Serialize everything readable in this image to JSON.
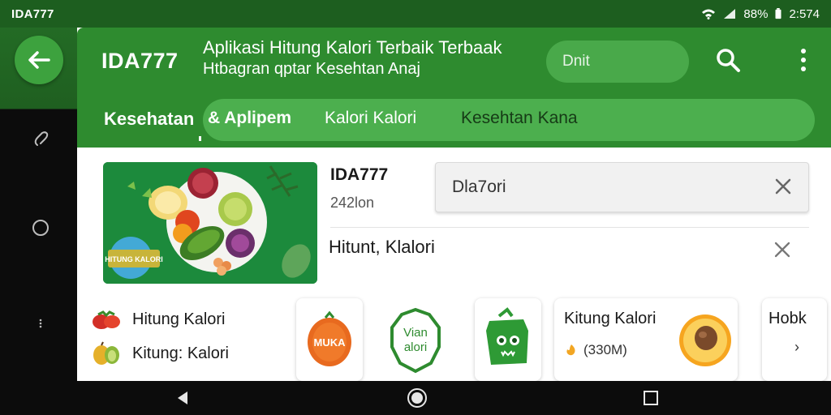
{
  "status_bar": {
    "carrier": "IDA777",
    "battery": "88%",
    "time": "2:574"
  },
  "app_bar": {
    "brand": "IDA777",
    "title_line1": "Aplikasi Hitung Kalori Terbaik Terbaak",
    "title_line2": "Htbagran qptar Kesehtan Anaj",
    "search_text": "Dnit"
  },
  "tabs": {
    "first": "Kesehatan",
    "items": [
      "& Aplipem",
      "Kalori Kalori",
      "Kesehtan Kana"
    ]
  },
  "hero": {
    "badge_text": "HITUNG KALORI",
    "name": "IDA777",
    "sub": "242lon"
  },
  "field_1": {
    "value": "Dla7ori"
  },
  "row_2": {
    "label": "Hitunt, Klalori"
  },
  "list": {
    "items": [
      {
        "label": "Hitung Kalori",
        "icon": "tomato-icon"
      },
      {
        "label": "Kitung: Kalori",
        "icon": "fruit-icon"
      }
    ]
  },
  "icon_cards": {
    "card1_text": "MUKA",
    "card2_text": "Vian alori",
    "card3_icon": "face-icon"
  },
  "food_card": {
    "name": "Kitung Kalori",
    "meta": "(330M)",
    "icon": "avocado-icon"
  },
  "more_card": {
    "name": "Hobk",
    "chevron": "›"
  },
  "colors": {
    "primary": "#2e8b2f",
    "primary_light": "#4caf4e",
    "status": "#1d5e1f"
  }
}
